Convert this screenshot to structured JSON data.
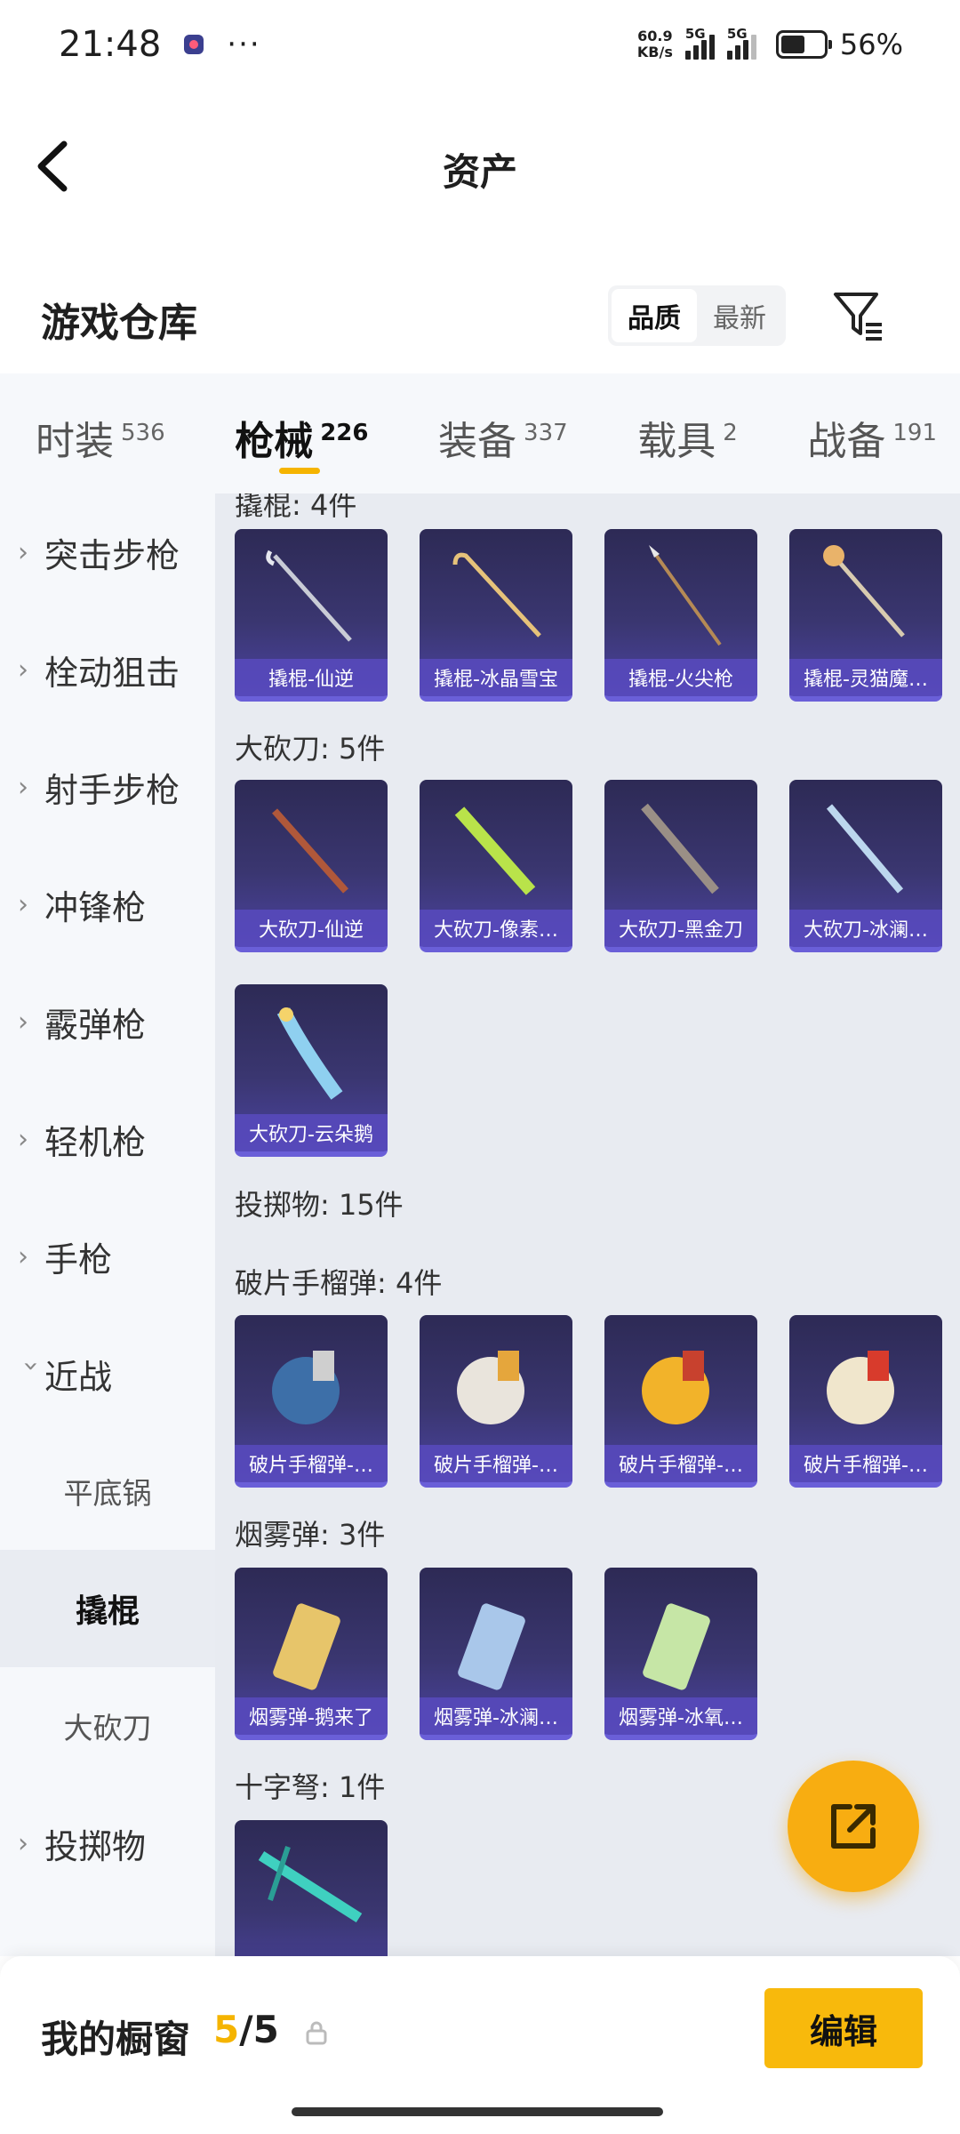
{
  "status_bar": {
    "time": "21:48",
    "more": "···",
    "net_speed_value": "60.9",
    "net_speed_unit": "KB/s",
    "signal1_label": "5G",
    "signal2_label": "5G",
    "battery": "56%"
  },
  "header": {
    "title": "资产"
  },
  "warehouse": {
    "title": "游戏仓库",
    "sort_quality": "品质",
    "sort_newest": "最新"
  },
  "tabs": [
    {
      "name": "时装",
      "count": "536"
    },
    {
      "name": "枪械",
      "count": "226"
    },
    {
      "name": "装备",
      "count": "337"
    },
    {
      "name": "载具",
      "count": "2"
    },
    {
      "name": "战备",
      "count": "191"
    }
  ],
  "sidebar": [
    {
      "label": "突击步枪"
    },
    {
      "label": "栓动狙击"
    },
    {
      "label": "射手步枪"
    },
    {
      "label": "冲锋枪"
    },
    {
      "label": "霰弹枪"
    },
    {
      "label": "轻机枪"
    },
    {
      "label": "手枪"
    },
    {
      "label": "近战"
    },
    {
      "label": "平底锅"
    },
    {
      "label": "撬棍"
    },
    {
      "label": "大砍刀"
    },
    {
      "label": "投掷物"
    }
  ],
  "groups": {
    "crowbar_partial": "撬棍: 4件",
    "machete": "大砍刀: 5件",
    "throwables": "投掷物: 15件",
    "frag": "破片手榴弹: 4件",
    "smoke": "烟雾弹: 3件",
    "crossbow": "十字弩: 1件"
  },
  "items": {
    "crowbar": [
      "撬棍-仙逆",
      "撬棍-冰晶雪宝",
      "撬棍-火尖枪",
      "撬棍-灵猫魔…"
    ],
    "machete": [
      "大砍刀-仙逆",
      "大砍刀-像素…",
      "大砍刀-黑金刀",
      "大砍刀-冰澜…",
      "大砍刀-云朵鹅"
    ],
    "frag": [
      "破片手榴弹-…",
      "破片手榴弹-…",
      "破片手榴弹-…",
      "破片手榴弹-…"
    ],
    "smoke": [
      "烟雾弹-鹅来了",
      "烟雾弹-冰澜…",
      "烟雾弹-冰氧…"
    ]
  },
  "showcase": {
    "title": "我的橱窗",
    "current": "5",
    "separator": "/",
    "total": "5",
    "edit": "编辑"
  },
  "colors": {
    "accent": "#f5b400",
    "card_bg": "#3a3670",
    "card_label": "#584abe"
  }
}
